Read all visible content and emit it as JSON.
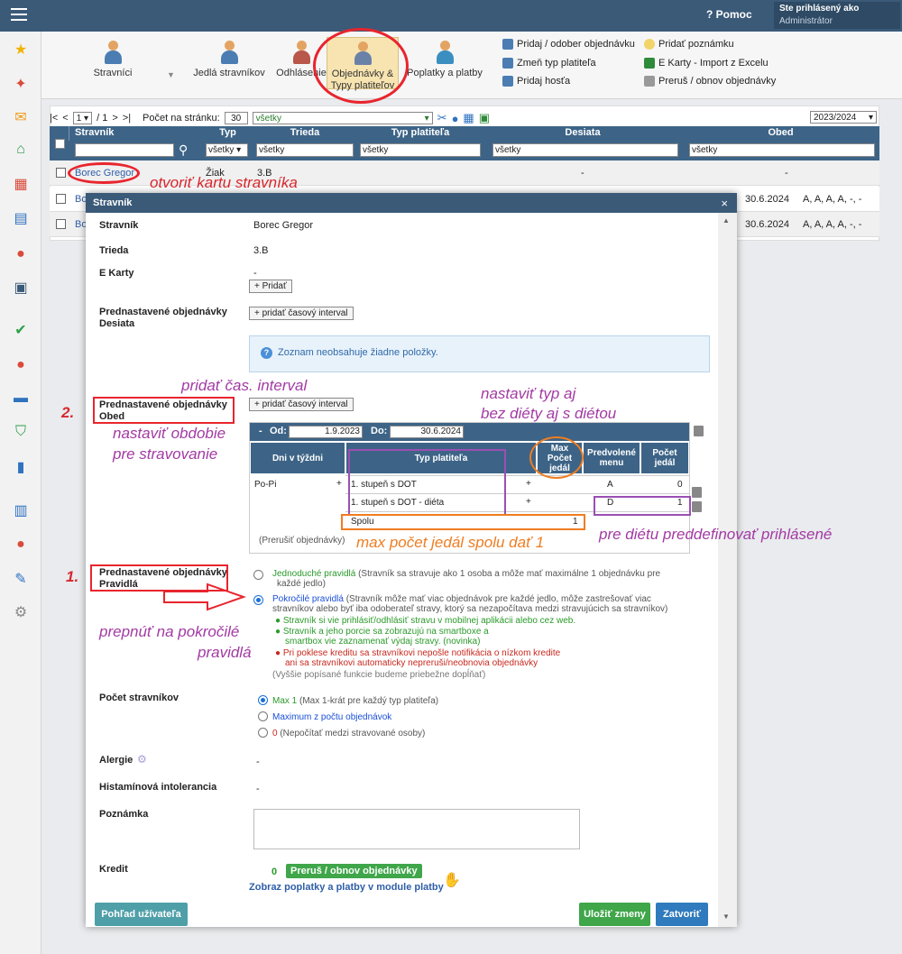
{
  "topbar": {
    "help_label": "Pomoc",
    "logged_in_label": "Ste prihlásený ako",
    "role": "Administrátor"
  },
  "ribbon": {
    "buttons": [
      "Stravníci",
      "Jedlá stravníkov",
      "Odhlásenie",
      "Objednávky &",
      "Typy platiteľov",
      "Poplatky a platby"
    ],
    "links": [
      "Pridaj / odober objednávku",
      "Zmeň typ platiteľa",
      "Pridaj hosťa",
      "Pridať poznámku",
      "E Karty - Import z Excelu",
      "Preruš / obnov objednávky"
    ]
  },
  "pager": {
    "first": "|<",
    "prev": "<",
    "page": "1",
    "of": "/ 1",
    "next": ">",
    "last": ">|",
    "per_page_label": "Počet na stránku:",
    "per_page": "30",
    "filter": "všetky",
    "year": "2023/2024"
  },
  "grid": {
    "headers": [
      "Stravník",
      "Typ",
      "Trieda",
      "Typ platiteľa",
      "Desiata",
      "Obed"
    ],
    "filters": [
      "všetky",
      "všetky",
      "všetky",
      "všetky",
      "všetky"
    ],
    "rows": [
      {
        "name": "Borec Gregor",
        "type": "Žiak",
        "class": "3.B",
        "payer": "",
        "desiata": "-",
        "obed": "-"
      },
      {
        "name": "Bo",
        "date": "30.6.2024",
        "obed": "A, A, A, A, -, -"
      },
      {
        "name": "Bo",
        "date": "30.6.2024",
        "obed": "A, A, A, A, -, -"
      }
    ]
  },
  "modal": {
    "title": "Stravník",
    "close": "×",
    "labels": {
      "stravnik": "Stravník",
      "trieda": "Trieda",
      "ekarty": "E Karty",
      "desiata1": "Prednastavené objednávky",
      "desiata2": "Desiata",
      "obed1": "Prednastavené objednávky",
      "obed2": "Obed",
      "pravidla1": "Prednastavené objednávky",
      "pravidla2": "Pravidlá",
      "pocet": "Počet stravníkov",
      "alergie": "Alergie",
      "histamin": "Histamínová intolerancia",
      "poznamka": "Poznámka",
      "kredit": "Kredit"
    },
    "values": {
      "stravnik": "Borec Gregor",
      "trieda": "3.B",
      "ekarty": "-",
      "alergie": "-",
      "histamin": "-",
      "kredit": "0"
    },
    "add_label": "+ Pridať",
    "add_interval": "+ pridať časový interval",
    "info": "Zoznam neobsahuje žiadne položky.",
    "interval": {
      "collapse": "-",
      "od_label": "Od:",
      "od": "1.9.2023",
      "do_label": "Do:",
      "do": "30.6.2024",
      "headers": [
        "Dni v týždni",
        "Typ platiteľa",
        "Max Počet jedál",
        "Predvolené menu",
        "Počet jedál"
      ],
      "days": "Po-Pi",
      "rows": [
        {
          "payer": "1. stupeň s DOT",
          "max": "",
          "menu": "A",
          "count": "0"
        },
        {
          "payer": "1. stupeň s DOT - diéta",
          "max": "",
          "menu": "D",
          "count": "1"
        }
      ],
      "total_label": "Spolu",
      "total": "1",
      "interrupt": "(Prerušiť objednávky)"
    },
    "rules": {
      "simple_title": "Jednoduché pravidlá",
      "simple_text": " (Stravník sa stravuje ako 1 osoba a môže mať maximálne 1 objednávku pre",
      "simple_text2": "každé jedlo)",
      "advanced_title": "Pokročilé pravidlá",
      "advanced_text": " (Stravník môže mať viac objednávok pre každé jedlo, môže zastrešovať viac",
      "advanced_text2": "stravníkov alebo byť iba odoberateľ stravy, ktorý sa nezapočítava medzi stravujúcich sa stravníkov)",
      "bullet1": "Stravník si vie prihlásiť/odhlásiť stravu v mobilnej aplikácii alebo cez web.",
      "bullet2a": "Stravník a jeho porcie sa zobrazujú na smartboxe a",
      "bullet2b": "smartbox vie zaznamenať výdaj stravy. (novinka)",
      "bullet3a": "Pri poklese kreditu sa stravníkovi nepošle notifikácia o nízkom kredite",
      "bullet3b": "ani sa stravníkovi automaticky nepreruši/neobnovia objednávky",
      "footnote": "(Vyššie popísané funkcie budeme priebežne dopĺňať)"
    },
    "count": {
      "opt1_title": "Max 1",
      "opt1_text": " (Max 1-krát pre každý typ platiteľa)",
      "opt2_title": "Maximum z počtu objednávok",
      "opt3_title": "0",
      "opt3_text": " (Nepočítať medzi stravované osoby)"
    },
    "credit_btn": "Preruš / obnov objednávky",
    "payments_link": "Zobraz poplatky a platby v module platby",
    "user_view": "Pohľad užívateľa",
    "save": "Uložiť zmeny",
    "close_btn": "Zatvoriť"
  },
  "annotations": {
    "open_card": "otvoriť kartu stravníka",
    "add_interval": "pridať čas. interval",
    "set_type1": "nastaviť typ aj",
    "set_type2": "bez diéty aj s diétou",
    "num2": "2.",
    "set_period1": "nastaviť obdobie",
    "set_period2": "pre stravovanie",
    "max_total": "max počet jedál spolu dať 1",
    "predefine": "pre diétu preddefinovať prihlásené",
    "num1": "1.",
    "switch1": "prepnúť na pokročilé",
    "switch2": "pravidlá"
  },
  "colors": {
    "topbar": "#3a5a78",
    "grid_header": "#3d6487",
    "annotation_purple": "#a23aa3",
    "annotation_red": "#d8272e",
    "annotation_orange": "#ef7d22",
    "save_green": "#3fa64a",
    "close_blue": "#2f7bbd"
  }
}
